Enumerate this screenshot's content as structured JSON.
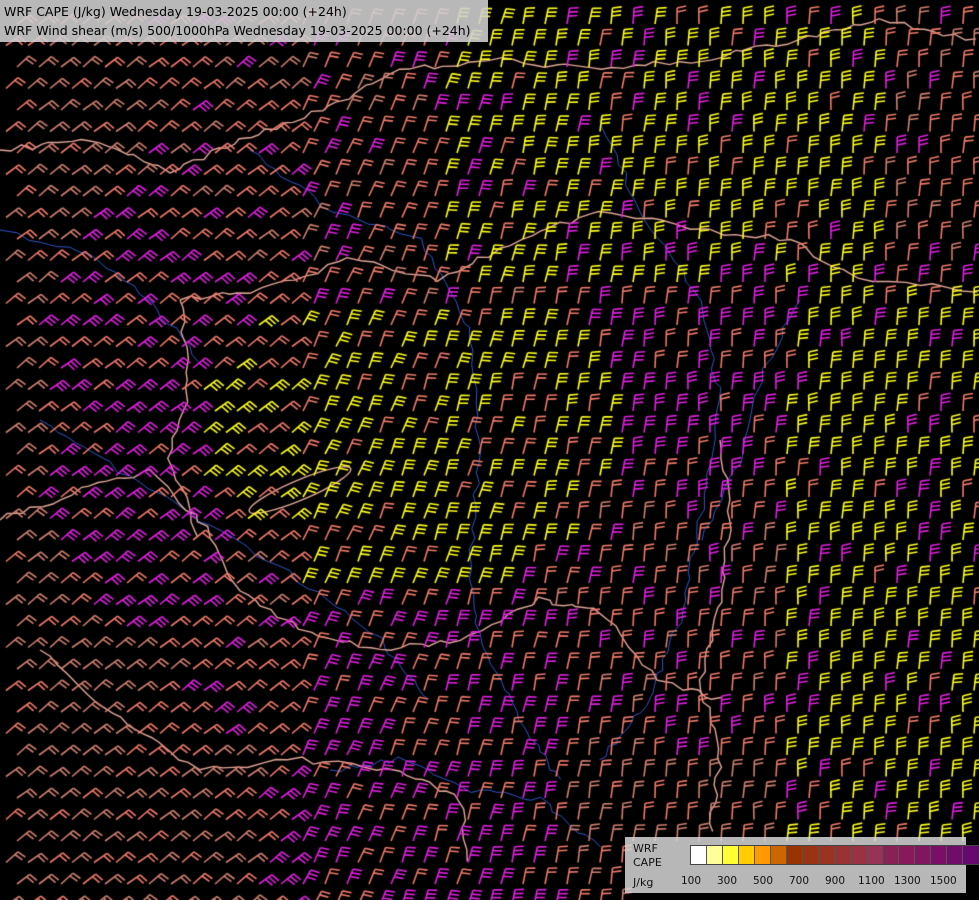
{
  "header": {
    "line1": "WRF CAPE (J/kg) Wednesday 19-03-2025 00:00 (+24h)",
    "line2": "WRF Wind shear (m/s) 500/1000hPa Wednesday 19-03-2025 00:00 (+24h)"
  },
  "legend": {
    "label_lines": [
      "WRF",
      "CAPE",
      "J/kg"
    ],
    "ticks": [
      "100",
      "300",
      "500",
      "700",
      "900",
      "1100",
      "1300",
      "1500"
    ],
    "colors": [
      "#ffffff",
      "#ffff99",
      "#ffff33",
      "#ffcc00",
      "#ff9900",
      "#cc6600",
      "#993300",
      "#993311",
      "#993322",
      "#993333",
      "#993344",
      "#993355",
      "#882255",
      "#881a5a",
      "#801560",
      "#7a1066",
      "#700c6a",
      "#66086e"
    ]
  },
  "map_style": {
    "background": "#000000",
    "barb_colors": {
      "low": "#d08070",
      "salmon": "#f07a6a",
      "magenta": "#e020e0",
      "yellow": "#ffff1a"
    },
    "border_color": "#e2a89a",
    "river_color": "#2f56c8"
  }
}
